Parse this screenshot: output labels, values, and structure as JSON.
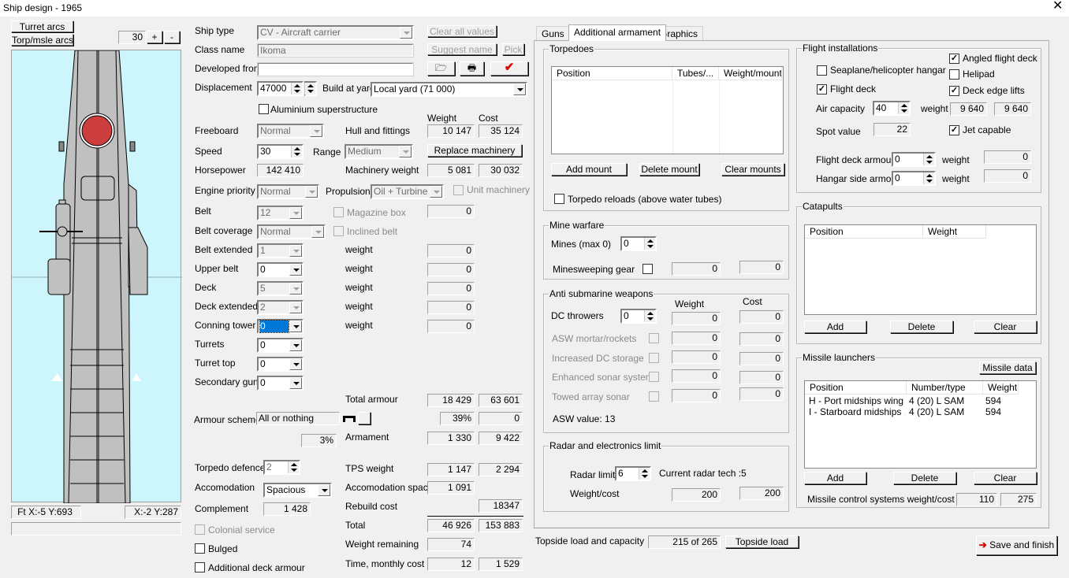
{
  "window": {
    "title": "Ship design - 1965",
    "close_icon": "close-icon"
  },
  "left": {
    "turret_arcs": "Turret arcs",
    "torp_arcs": "Torp/msle arcs",
    "zoom": "30",
    "plus": "+",
    "minus": "-",
    "status_ft": "Ft X:-5 Y:693",
    "status_xy": "X:-2 Y:287",
    "water_color": "#ccf6fc",
    "hull_color": "#c0c0c0",
    "marking_color": "#cc3e3e"
  },
  "design": {
    "ship_type_label": "Ship type",
    "ship_type": "CV - Aircraft carrier",
    "clear_all": "Clear all values",
    "class_name_label": "Class name",
    "class_name": "Ikoma",
    "suggest_name": "Suggest name",
    "pick": "Pick",
    "developed_from_label": "Developed from",
    "developed_from": "",
    "displacement_label": "Displacement",
    "displacement": "47000",
    "build_yard_label": "Build at yard",
    "build_yard": "Local yard (71 000)",
    "aluminium": "Aluminium superstructure",
    "weight_header": "Weight",
    "cost_header": "Cost",
    "freeboard_label": "Freeboard",
    "freeboard": "Normal",
    "hull_label": "Hull and fittings",
    "hull_weight": "10 147",
    "hull_cost": "35 124",
    "speed_label": "Speed",
    "speed": "30",
    "range_label": "Range",
    "range": "Medium",
    "replace_machinery": "Replace machinery",
    "horsepower_label": "Horsepower",
    "horsepower": "142 410",
    "machinery_label": "Machinery weight",
    "machinery_weight": "5 081",
    "machinery_cost": "30 032",
    "engine_priority_label": "Engine priority",
    "engine_priority": "Normal",
    "propulsion_label": "Propulsion",
    "propulsion": "Oil + Turbine",
    "unit_machinery": "Unit machinery",
    "belt_label": "Belt",
    "belt": "12",
    "magazine_box": "Magazine box",
    "magazine_value": "0",
    "belt_coverage_label": "Belt coverage",
    "belt_coverage": "Normal",
    "inclined_belt": "Inclined belt",
    "belt_extended_label": "Belt extended",
    "belt_extended": "1",
    "upper_belt_label": "Upper belt",
    "upper_belt": "0",
    "deck_label": "Deck",
    "deck": "5",
    "deck_extended_label": "Deck extended",
    "deck_extended": "2",
    "conning_tower_label": "Conning tower",
    "conning_tower": "0",
    "turrets_label": "Turrets",
    "turrets": "0",
    "turret_top_label": "Turret top",
    "turret_top": "0",
    "secondary_guns_label": "Secondary guns",
    "secondary_guns": "0",
    "weight_word": "weight",
    "zero": "0",
    "total_armour_label": "Total armour",
    "total_armour_weight": "18 429",
    "total_armour_cost": "63 601",
    "armour_scheme_label": "Armour scheme",
    "armour_scheme": "All or nothing",
    "armour_pct": "39%",
    "armour_pct_cost": "0",
    "small_pct": "3%",
    "armament_label": "Armament",
    "armament_weight": "1 330",
    "armament_cost": "9 422",
    "torpedo_defence_label": "Torpedo defence",
    "torpedo_defence": "2",
    "tps_label": "TPS weight",
    "tps_weight": "1 147",
    "tps_cost": "2 294",
    "accomodation_label": "Accomodation",
    "accomodation": "Spacious",
    "acc_space_label": "Accomodation space",
    "acc_space": "1 091",
    "complement_label": "Complement",
    "complement": "1 428",
    "rebuild_label": "Rebuild cost",
    "rebuild_cost": "18347",
    "colonial": "Colonial service",
    "total_label": "Total",
    "total_weight": "46 926",
    "total_cost": "153 883",
    "bulged": "Bulged",
    "weight_remaining_label": "Weight remaining",
    "weight_remaining": "74",
    "additional_deck": "Additional deck armour",
    "time_label": "Time, monthly cost",
    "time": "12",
    "monthly_cost": "1 529"
  },
  "tabs": [
    {
      "label": "Guns"
    },
    {
      "label": "Additional armament",
      "active": true
    },
    {
      "label": "Graphics"
    }
  ],
  "torpedoes": {
    "title": "Torpedoes",
    "columns": [
      "Position",
      "Tubes/...",
      "Weight/mount"
    ],
    "rows": [],
    "add": "Add mount",
    "delete": "Delete mount",
    "clear": "Clear mounts",
    "reloads": "Torpedo reloads (above water tubes)"
  },
  "mines": {
    "title": "Mine warfare",
    "mines_label": "Mines (max 0)",
    "mines": "0",
    "minesweeping": "Minesweeping gear",
    "v1": "0",
    "v2": "0"
  },
  "asw": {
    "title": "Anti submarine weapons",
    "weight": "Weight",
    "cost": "Cost",
    "dc_label": "DC throwers",
    "dc": "0",
    "rows": [
      {
        "label": "DC throwers",
        "w": "0",
        "c": "0"
      },
      {
        "label": "ASW mortar/rockets",
        "w": "0",
        "c": "0"
      },
      {
        "label": "Increased DC storage",
        "w": "0",
        "c": "0"
      },
      {
        "label": "Enhanced sonar system",
        "w": "0",
        "c": "0"
      },
      {
        "label": "Towed array sonar",
        "w": "0",
        "c": "0"
      }
    ],
    "value": "ASW value: 13"
  },
  "radar": {
    "title": "Radar and electronics limit",
    "limit_label": "Radar limit",
    "limit": "6",
    "current": "Current radar tech :5",
    "wc_label": "Weight/cost",
    "weight": "200",
    "cost": "200"
  },
  "topside": {
    "label": "Topside load and capacity",
    "value": "215 of 265",
    "button": "Topside load"
  },
  "flight": {
    "title": "Flight installations",
    "angled": "Angled flight deck",
    "seaplane": "Seaplane/helicopter hangar",
    "helipad": "Helipad",
    "flight_deck": "Flight deck",
    "deck_edge": "Deck edge lifts",
    "air_label": "Air capacity",
    "air": "40",
    "weight": "weight",
    "air_w": "9 640",
    "air_c": "9 640",
    "spot_label": "Spot value",
    "spot": "22",
    "jet": "Jet capable",
    "fd_armour_label": "Flight deck armour",
    "fd_armour": "0",
    "fd_w": "0",
    "hs_armour_label": "Hangar side armour",
    "hs_armour": "0",
    "hs_w": "0",
    "checked": {
      "angled": true,
      "seaplane": false,
      "helipad": false,
      "flight_deck": true,
      "deck_edge": true,
      "jet": true
    }
  },
  "catapults": {
    "title": "Catapults",
    "columns": [
      "Position",
      "Weight"
    ],
    "rows": [],
    "add": "Add",
    "delete": "Delete",
    "clear": "Clear"
  },
  "missiles": {
    "title": "Missile launchers",
    "data_button": "Missile data",
    "columns": [
      "Position",
      "Number/type",
      "Weight"
    ],
    "rows": [
      {
        "position": "H - Port midships wing",
        "type": "4 (20) L SAM",
        "weight": "594"
      },
      {
        "position": "I - Starboard midships ...",
        "type": "4 (20) L SAM",
        "weight": "594"
      }
    ],
    "add": "Add",
    "delete": "Delete",
    "clear": "Clear",
    "control_label": "Missile control systems weight/cost",
    "control_w": "110",
    "control_c": "275"
  },
  "save": "Save and finish"
}
